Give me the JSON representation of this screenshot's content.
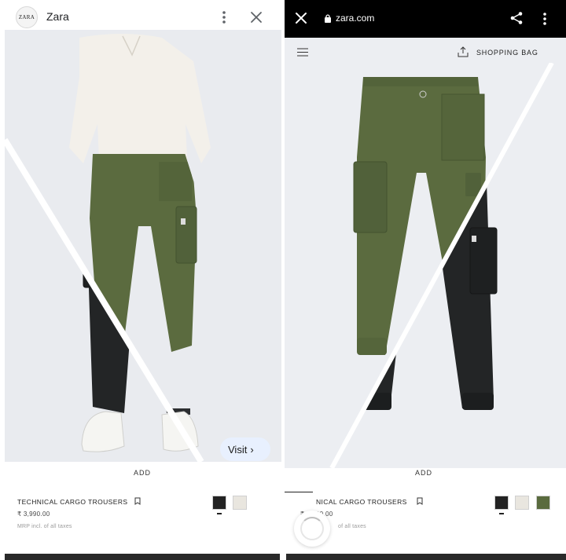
{
  "left_panel": {
    "header": {
      "logo_text": "ZARA",
      "brand_name": "Zara",
      "icons": [
        "more-vert-icon",
        "close-icon"
      ]
    },
    "visit_button": {
      "label": "Visit",
      "chevron": "›"
    },
    "product": {
      "add_label": "ADD",
      "name": "TECHNICAL CARGO TROUSERS",
      "price": "₹ 3,990.00",
      "tax_note": "MRP incl. of all taxes",
      "swatches": [
        "#222222",
        "#e9e6df",
        "#5a6b3e"
      ]
    }
  },
  "right_panel": {
    "top_bar": {
      "url": "zara.com",
      "icons": [
        "close-icon",
        "lock-icon",
        "share-icon",
        "more-vert-icon"
      ]
    },
    "site_header": {
      "shopping_bag_label": "SHOPPING BAG"
    },
    "product": {
      "add_label": "ADD",
      "name_visible": "NICAL CARGO TROUSERS",
      "price_visible": "₹ 3,990.00",
      "tax_note_visible": "of all taxes",
      "swatches": [
        "#222222",
        "#e9e6df",
        "#5a6b3e"
      ]
    }
  },
  "colors": {
    "olive": "#5b6b3f",
    "black_pants": "#232526",
    "background_photo": "#e9ebef",
    "visit_pill": "#e8f0fe",
    "topbar": "#000000"
  }
}
